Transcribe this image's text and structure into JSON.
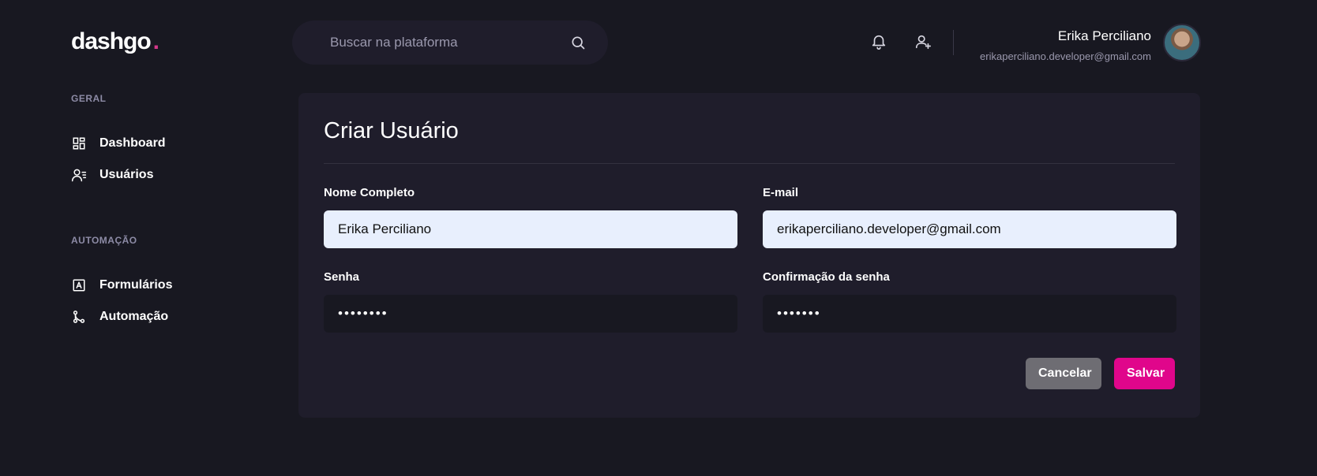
{
  "logo": {
    "text": "dashgo",
    "dot": ".",
    "dot_color": "#d6388b"
  },
  "search": {
    "placeholder": "Buscar na plataforma",
    "icon": "search-icon"
  },
  "header": {
    "icons": [
      "bell-icon",
      "user-add-icon"
    ],
    "user": {
      "name": "Erika Perciliano",
      "email": "erikaperciliano.developer@gmail.com"
    }
  },
  "sidebar": {
    "sections": [
      {
        "label": "GERAL",
        "items": [
          {
            "label": "Dashboard",
            "icon": "dashboard-icon"
          },
          {
            "label": "Usuários",
            "icon": "users-icon"
          }
        ]
      },
      {
        "label": "AUTOMAÇÃO",
        "items": [
          {
            "label": "Formulários",
            "icon": "form-icon"
          },
          {
            "label": "Automação",
            "icon": "git-branch-icon"
          }
        ]
      }
    ]
  },
  "form": {
    "title": "Criar Usuário",
    "fields": {
      "name": {
        "label": "Nome Completo",
        "value": "Erika Perciliano"
      },
      "email": {
        "label": "E-mail",
        "value": "erikaperciliano.developer@gmail.com"
      },
      "password": {
        "label": "Senha",
        "value": "••••••••"
      },
      "password_confirmation": {
        "label": "Confirmação da senha",
        "value": "•••••••"
      }
    },
    "buttons": {
      "cancel": "Cancelar",
      "save": "Salvar"
    }
  },
  "colors": {
    "background": "#181821",
    "card": "#1f1d2b",
    "accent": "#e0068b",
    "cancel": "#6e6d73",
    "input_filled": "#e8effd"
  }
}
